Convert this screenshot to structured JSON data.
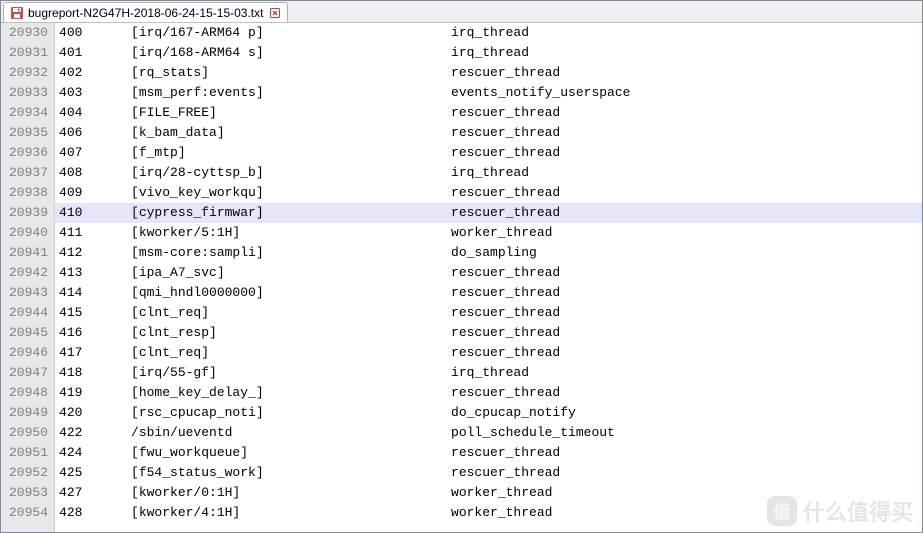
{
  "tab": {
    "filename": "bugreport-N2G47H-2018-06-24-15-15-03.txt",
    "icon": "file-save-icon",
    "close_icon": "close-icon"
  },
  "highlighted_line": 20939,
  "rows": [
    {
      "ln": 20930,
      "pid": "400",
      "name": "[irq/167-ARM64 p]",
      "func": "irq_thread"
    },
    {
      "ln": 20931,
      "pid": "401",
      "name": "[irq/168-ARM64 s]",
      "func": "irq_thread"
    },
    {
      "ln": 20932,
      "pid": "402",
      "name": "[rq_stats]",
      "func": "rescuer_thread"
    },
    {
      "ln": 20933,
      "pid": "403",
      "name": "[msm_perf:events]",
      "func": "events_notify_userspace"
    },
    {
      "ln": 20934,
      "pid": "404",
      "name": "[FILE_FREE]",
      "func": "rescuer_thread"
    },
    {
      "ln": 20935,
      "pid": "406",
      "name": "[k_bam_data]",
      "func": "rescuer_thread"
    },
    {
      "ln": 20936,
      "pid": "407",
      "name": "[f_mtp]",
      "func": "rescuer_thread"
    },
    {
      "ln": 20937,
      "pid": "408",
      "name": "[irq/28-cyttsp_b]",
      "func": "irq_thread"
    },
    {
      "ln": 20938,
      "pid": "409",
      "name": "[vivo_key_workqu]",
      "func": "rescuer_thread"
    },
    {
      "ln": 20939,
      "pid": "410",
      "name": "[cypress_firmwar]",
      "func": "rescuer_thread"
    },
    {
      "ln": 20940,
      "pid": "411",
      "name": "[kworker/5:1H]",
      "func": "worker_thread"
    },
    {
      "ln": 20941,
      "pid": "412",
      "name": "[msm-core:sampli]",
      "func": "do_sampling"
    },
    {
      "ln": 20942,
      "pid": "413",
      "name": "[ipa_A7_svc]",
      "func": "rescuer_thread"
    },
    {
      "ln": 20943,
      "pid": "414",
      "name": "[qmi_hndl0000000]",
      "func": "rescuer_thread"
    },
    {
      "ln": 20944,
      "pid": "415",
      "name": "[clnt_req]",
      "func": "rescuer_thread"
    },
    {
      "ln": 20945,
      "pid": "416",
      "name": "[clnt_resp]",
      "func": "rescuer_thread"
    },
    {
      "ln": 20946,
      "pid": "417",
      "name": "[clnt_req]",
      "func": "rescuer_thread"
    },
    {
      "ln": 20947,
      "pid": "418",
      "name": "[irq/55-gf]",
      "func": "irq_thread"
    },
    {
      "ln": 20948,
      "pid": "419",
      "name": "[home_key_delay_]",
      "func": "rescuer_thread"
    },
    {
      "ln": 20949,
      "pid": "420",
      "name": "[rsc_cpucap_noti]",
      "func": "do_cpucap_notify"
    },
    {
      "ln": 20950,
      "pid": "422",
      "name": "/sbin/ueventd",
      "func": "poll_schedule_timeout"
    },
    {
      "ln": 20951,
      "pid": "424",
      "name": "[fwu_workqueue]",
      "func": "rescuer_thread"
    },
    {
      "ln": 20952,
      "pid": "425",
      "name": "[f54_status_work]",
      "func": "rescuer_thread"
    },
    {
      "ln": 20953,
      "pid": "427",
      "name": "[kworker/0:1H]",
      "func": "worker_thread"
    },
    {
      "ln": 20954,
      "pid": "428",
      "name": "[kworker/4:1H]",
      "func": "worker_thread"
    }
  ],
  "watermark": {
    "badge": "值",
    "text": "什么值得买"
  }
}
